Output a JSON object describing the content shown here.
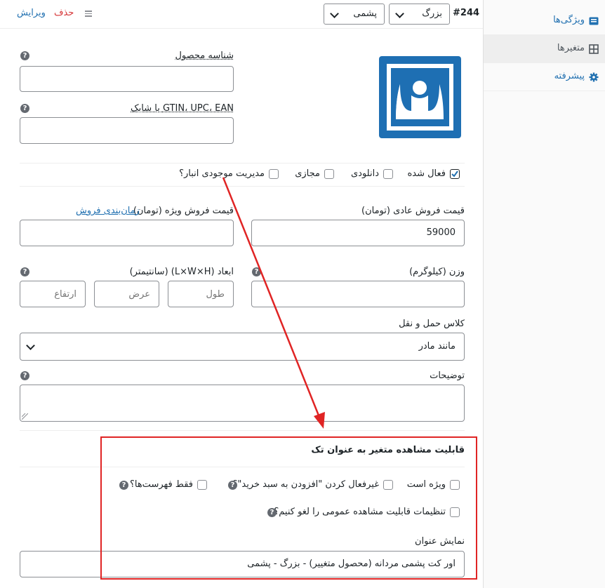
{
  "sidebar": {
    "items": [
      {
        "label": "ویژگی‌ها",
        "icon": "table-icon"
      },
      {
        "label": "متغیرها",
        "icon": "grid-icon"
      },
      {
        "label": "پیشرفته",
        "icon": "gear-icon"
      }
    ]
  },
  "header": {
    "variation_id": "#244",
    "size_select": "بزرگ",
    "material_select": "پشمی",
    "delete_link": "حذف",
    "edit_link": "ویرایش"
  },
  "fields": {
    "sku_label": "شناسه محصول",
    "sku_value": "",
    "gtin_label": "GTIN، UPC، EAN یا شابک",
    "gtin_value": "",
    "enabled_label": "فعال شده",
    "downloadable_label": "دانلودی",
    "virtual_label": "مجازی",
    "manage_stock_label": "مدیریت موجودی انبار؟",
    "regular_price_label": "قیمت فروش عادی (تومان)",
    "regular_price_value": "59000",
    "sale_price_label": "قیمت فروش ویژه (تومان)",
    "sale_schedule_link": "زمان‌بندی فروش",
    "sale_price_value": "",
    "weight_label": "وزن (کیلوگرم)",
    "dimensions_label": "ابعاد (L×W×H) (سانتیمتر)",
    "length_placeholder": "طول",
    "width_placeholder": "عرض",
    "height_placeholder": "ارتفاع",
    "shipping_class_label": "کلاس حمل و نقل",
    "shipping_class_value": "مانند مادر",
    "description_label": "توضیحات"
  },
  "visibility": {
    "section_title": "قابلیت مشاهده متغیر به عنوان تک",
    "featured_label": "ویژه است",
    "disable_add_to_cart_label": "غیرفعال کردن \"افزودن به سبد خرید\"؟",
    "catalog_only_label": "فقط فهرست‌ها؟",
    "override_visibility_label": "تنظیمات قابلیت مشاهده عمومی را لغو کنیم؟",
    "display_title_label": "نمایش عنوان",
    "display_title_value": "اور کت پشمی مردانه (محصول متغییر) - بزرگ -  پشمی"
  },
  "colors": {
    "accent": "#2271b1",
    "danger": "#d63638",
    "annotation": "#e02424",
    "image_placeholder": "#1e6fb3"
  }
}
